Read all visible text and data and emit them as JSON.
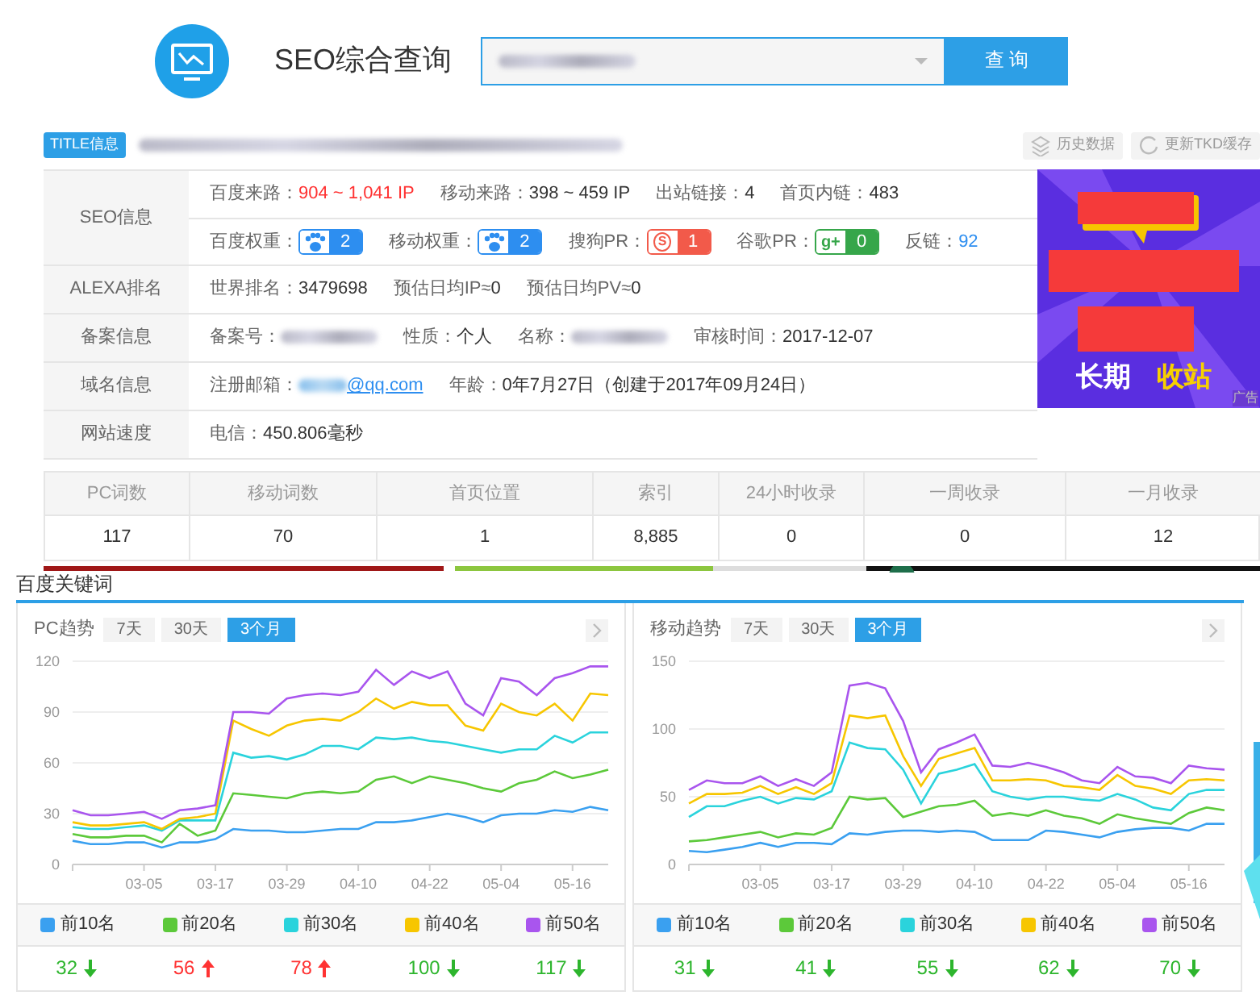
{
  "header": {
    "title": "SEO综合查询",
    "search_button": "查 询"
  },
  "title_bar": {
    "badge": "TITLE信息",
    "buttons": [
      {
        "label": "历史数据",
        "kind": "history"
      },
      {
        "label": "更新TKD缓存",
        "kind": "refresh"
      }
    ]
  },
  "info_rows": [
    {
      "label": "SEO信息",
      "lines": [
        [
          {
            "label": "百度来路：",
            "value": "904 ~ 1,041 IP",
            "kind": "alert"
          },
          {
            "label": "移动来路：",
            "value": "398 ~ 459 IP",
            "kind": "plain"
          },
          {
            "label": "出站链接：",
            "value": "4",
            "kind": "plain"
          },
          {
            "label": "首页内链：",
            "value": "483",
            "kind": "plain"
          }
        ],
        [
          {
            "label": "百度权重：",
            "badge": {
              "kind": "baidu",
              "value": "2"
            }
          },
          {
            "label": "移动权重：",
            "badge": {
              "kind": "baidu",
              "value": "2"
            }
          },
          {
            "label": "搜狗PR：",
            "badge": {
              "kind": "sogou",
              "icon_text": "S",
              "value": "1"
            }
          },
          {
            "label": "谷歌PR：",
            "badge": {
              "kind": "google",
              "icon_text": "g+",
              "value": "0"
            }
          },
          {
            "label": "反链：",
            "value": "92",
            "kind": "link"
          }
        ]
      ]
    },
    {
      "label": "ALEXA排名",
      "lines": [
        [
          {
            "label": "世界排名：",
            "value": "3479698",
            "kind": "plain"
          },
          {
            "label": "预估日均IP≈",
            "value": "0",
            "kind": "plain"
          },
          {
            "label": "预估日均PV≈",
            "value": "0",
            "kind": "plain"
          }
        ]
      ]
    },
    {
      "label": "备案信息",
      "lines": [
        [
          {
            "label": "备案号：",
            "redacted": true
          },
          {
            "label": "性质：",
            "value": "个人",
            "kind": "plain"
          },
          {
            "label": "名称：",
            "redacted": true
          },
          {
            "label": "审核时间：",
            "value": "2017-12-07",
            "kind": "plain"
          }
        ]
      ]
    },
    {
      "label": "域名信息",
      "lines": [
        [
          {
            "label": "注册邮箱：",
            "redacted": true,
            "value": "@qq.com",
            "kind": "link"
          },
          {
            "label": "年龄：",
            "value": "0年7月27日（创建于2017年09月24日）",
            "kind": "plain"
          }
        ]
      ]
    },
    {
      "label": "网站速度",
      "lines": [
        [
          {
            "label": "电信：",
            "value": "450.806毫秒",
            "kind": "plain"
          }
        ]
      ]
    }
  ],
  "ad": {
    "words": [
      "长期",
      "收站"
    ],
    "tag": "广告"
  },
  "stats": {
    "columns": [
      "PC词数",
      "移动词数",
      "首页位置",
      "索引",
      "24小时收录",
      "一周收录",
      "一月收录"
    ],
    "values": [
      "117",
      "70",
      "1",
      "8,885",
      "0",
      "0",
      "12"
    ]
  },
  "section_title": "百度关键词",
  "trend_panels": [
    {
      "label": "PC趋势",
      "tabs": [
        {
          "label": "7天",
          "selected": false
        },
        {
          "label": "30天",
          "selected": false
        },
        {
          "label": "3个月",
          "selected": true
        }
      ],
      "chart_data": {
        "type": "line",
        "categories": [
          null,
          null,
          null,
          null,
          "03-05",
          null,
          null,
          null,
          "03-17",
          null,
          null,
          null,
          "03-29",
          null,
          null,
          null,
          "04-10",
          null,
          null,
          null,
          "04-22",
          null,
          null,
          null,
          "05-04",
          null,
          null,
          null,
          "05-16",
          null,
          null
        ],
        "ylim": [
          0,
          120
        ],
        "yticks": [
          0,
          30,
          60,
          90,
          120
        ],
        "grid": true,
        "series": [
          {
            "name": "前10名",
            "color": "#3aa0f0",
            "values": [
              14,
              12,
              12,
              13,
              13,
              10,
              13,
              13,
              15,
              21,
              20,
              20,
              19,
              19,
              20,
              21,
              21,
              25,
              25,
              26,
              28,
              30,
              28,
              25,
              29,
              30,
              30,
              32,
              31,
              34,
              32
            ]
          },
          {
            "name": "前20名",
            "color": "#5cc93a",
            "values": [
              18,
              16,
              16,
              17,
              17,
              13,
              24,
              17,
              20,
              42,
              41,
              40,
              39,
              42,
              43,
              42,
              43,
              50,
              52,
              48,
              52,
              50,
              48,
              45,
              43,
              48,
              50,
              55,
              51,
              53,
              56
            ]
          },
          {
            "name": "前30名",
            "color": "#2ad3dc",
            "values": [
              22,
              21,
              21,
              22,
              23,
              20,
              26,
              26,
              26,
              66,
              63,
              64,
              62,
              65,
              70,
              70,
              68,
              75,
              74,
              75,
              73,
              72,
              70,
              68,
              66,
              68,
              68,
              76,
              72,
              78,
              78
            ]
          },
          {
            "name": "前40名",
            "color": "#f7c600",
            "values": [
              25,
              23,
              23,
              24,
              25,
              21,
              27,
              28,
              30,
              85,
              80,
              76,
              82,
              85,
              86,
              85,
              90,
              98,
              92,
              96,
              94,
              94,
              82,
              79,
              95,
              90,
              88,
              95,
              85,
              101,
              100
            ]
          },
          {
            "name": "前50名",
            "color": "#a955ee",
            "values": [
              32,
              29,
              29,
              30,
              31,
              27,
              32,
              33,
              35,
              90,
              90,
              89,
              98,
              100,
              101,
              100,
              102,
              115,
              106,
              114,
              110,
              114,
              95,
              88,
              110,
              108,
              100,
              110,
              113,
              117,
              117
            ]
          }
        ]
      },
      "summary": [
        {
          "value": "32",
          "kind": "down"
        },
        {
          "value": "56",
          "kind": "up"
        },
        {
          "value": "78",
          "kind": "up"
        },
        {
          "value": "100",
          "kind": "down"
        },
        {
          "value": "117",
          "kind": "down"
        }
      ]
    },
    {
      "label": "移动趋势",
      "tabs": [
        {
          "label": "7天",
          "selected": false
        },
        {
          "label": "30天",
          "selected": false
        },
        {
          "label": "3个月",
          "selected": true
        }
      ],
      "chart_data": {
        "type": "line",
        "categories": [
          null,
          null,
          null,
          null,
          "03-05",
          null,
          null,
          null,
          "03-17",
          null,
          null,
          null,
          "03-29",
          null,
          null,
          null,
          "04-10",
          null,
          null,
          null,
          "04-22",
          null,
          null,
          null,
          "05-04",
          null,
          null,
          null,
          "05-16",
          null,
          null
        ],
        "ylim": [
          0,
          150
        ],
        "yticks": [
          0,
          50,
          100,
          150
        ],
        "grid": true,
        "series": [
          {
            "name": "前10名",
            "color": "#3aa0f0",
            "values": [
              10,
              9,
              11,
              13,
              16,
              13,
              16,
              16,
              15,
              23,
              22,
              24,
              25,
              25,
              24,
              25,
              24,
              18,
              18,
              18,
              25,
              24,
              22,
              20,
              24,
              26,
              27,
              27,
              25,
              30,
              30
            ]
          },
          {
            "name": "前20名",
            "color": "#5cc93a",
            "values": [
              17,
              18,
              20,
              22,
              24,
              20,
              23,
              22,
              27,
              50,
              48,
              49,
              35,
              39,
              43,
              44,
              47,
              36,
              38,
              36,
              40,
              36,
              34,
              30,
              37,
              34,
              32,
              30,
              38,
              42,
              40
            ]
          },
          {
            "name": "前30名",
            "color": "#2ad3dc",
            "values": [
              35,
              43,
              43,
              47,
              50,
              45,
              49,
              48,
              54,
              90,
              86,
              85,
              70,
              45,
              67,
              70,
              74,
              54,
              50,
              48,
              50,
              50,
              48,
              47,
              52,
              48,
              42,
              40,
              52,
              55,
              55
            ]
          },
          {
            "name": "前40名",
            "color": "#f7c600",
            "values": [
              45,
              52,
              52,
              53,
              58,
              52,
              57,
              52,
              60,
              110,
              108,
              110,
              80,
              58,
              78,
              82,
              86,
              62,
              62,
              63,
              62,
              58,
              57,
              55,
              66,
              58,
              56,
              52,
              62,
              63,
              62
            ]
          },
          {
            "name": "前50名",
            "color": "#a955ee",
            "values": [
              55,
              62,
              60,
              60,
              65,
              58,
              63,
              58,
              68,
              132,
              134,
              130,
              106,
              68,
              85,
              90,
              96,
              73,
              72,
              75,
              72,
              68,
              62,
              60,
              72,
              65,
              64,
              60,
              73,
              71,
              70
            ]
          }
        ]
      },
      "summary": [
        {
          "value": "31",
          "kind": "down"
        },
        {
          "value": "41",
          "kind": "down"
        },
        {
          "value": "55",
          "kind": "down"
        },
        {
          "value": "62",
          "kind": "down"
        },
        {
          "value": "70",
          "kind": "down"
        }
      ]
    }
  ]
}
